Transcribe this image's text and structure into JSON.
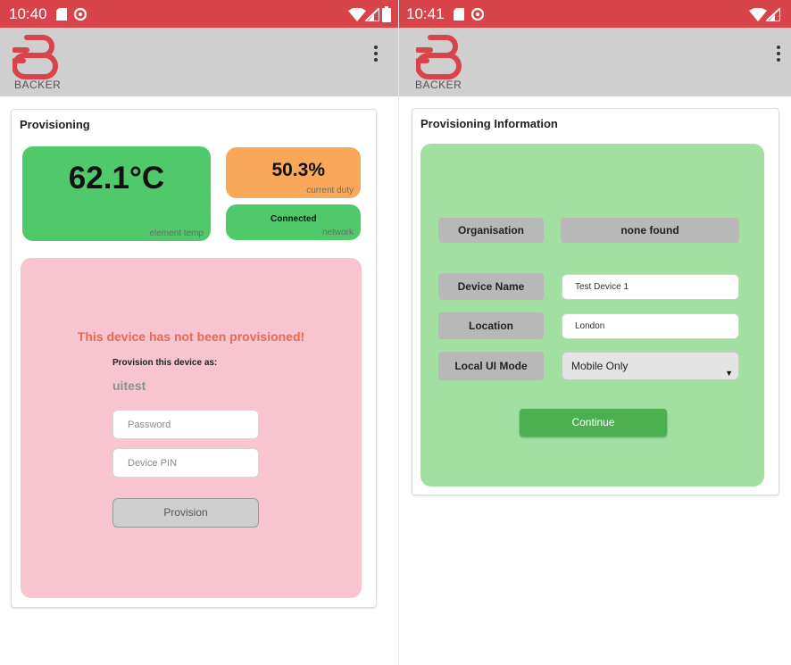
{
  "colors": {
    "status_bar": "#d9434a",
    "app_bar": "#cfcfcf",
    "tile_green": "#4fc96a",
    "tile_orange": "#f9a85a",
    "panel_pink": "#f8c4d0",
    "panel_green": "#a1e0a1",
    "warning_text": "#e86a50",
    "button_green": "#4caf50"
  },
  "left_screen": {
    "status_bar": {
      "time": "10:40",
      "icons": [
        "sd-card-icon",
        "data-saver-icon",
        "wifi-icon",
        "signal-icon",
        "battery-icon"
      ]
    },
    "app_bar": {
      "logo_text": "BACKER",
      "menu_icon": "overflow-menu-icon"
    },
    "card": {
      "title": "Provisioning",
      "temperature": {
        "value": "62.1°C",
        "caption": "element temp"
      },
      "duty": {
        "value": "50.3%",
        "caption": "current duty"
      },
      "network": {
        "value": "Connected",
        "caption": "network"
      },
      "warning": "This device has not been provisioned!",
      "provision_as_label": "Provision this device as:",
      "username": "uitest",
      "password_placeholder": "Password",
      "pin_placeholder": "Device PIN",
      "provision_button": "Provision"
    }
  },
  "right_screen": {
    "status_bar": {
      "time": "10:41",
      "icons": [
        "sd-card-icon",
        "data-saver-icon",
        "wifi-icon",
        "signal-icon"
      ]
    },
    "app_bar": {
      "logo_text": "BACKER",
      "menu_icon": "overflow-menu-icon"
    },
    "card": {
      "title": "Provisioning Information",
      "organisation_label": "Organisation",
      "organisation_value": "none found",
      "device_name_label": "Device Name",
      "device_name_value": "Test Device 1",
      "location_label": "Location",
      "location_value": "London",
      "local_ui_mode_label": "Local UI Mode",
      "local_ui_mode_value": "Mobile Only",
      "continue_button": "Continue"
    }
  }
}
